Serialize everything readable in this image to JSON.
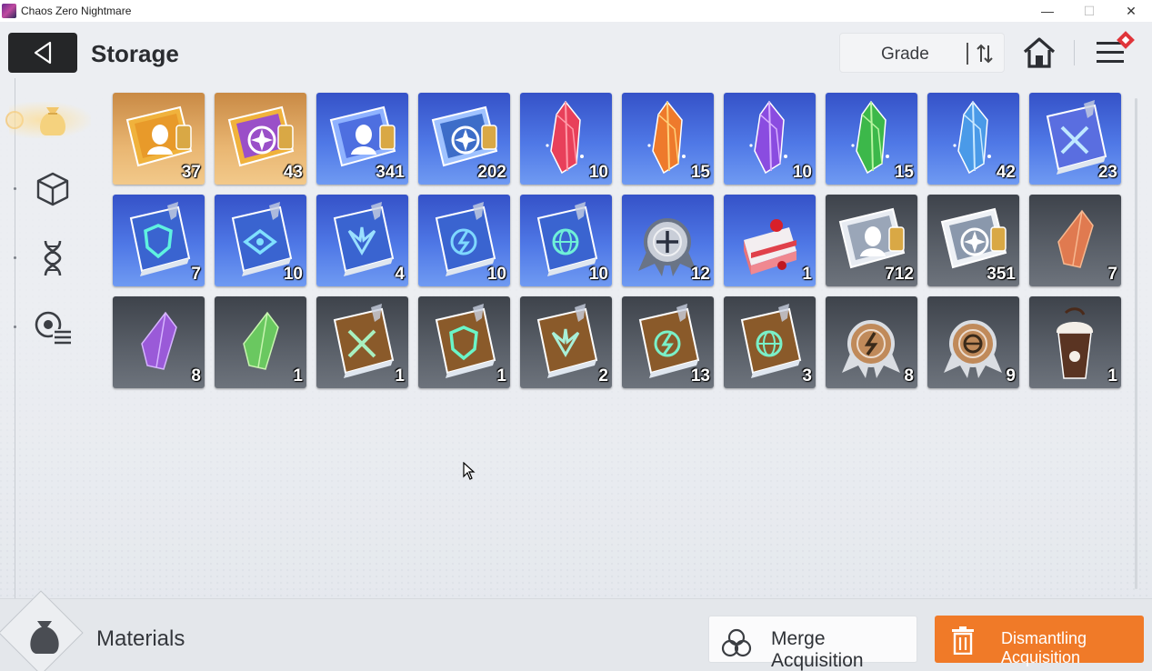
{
  "window": {
    "title": "Chaos Zero Nightmare",
    "controls": {
      "minimize": "—",
      "maximize": "☐",
      "close": "✕"
    }
  },
  "header": {
    "title": "Storage",
    "sort_label": "Grade"
  },
  "sidebar": {
    "tabs": [
      {
        "name": "materials-tab",
        "icon": "money-bag-icon",
        "active": true
      },
      {
        "name": "cube-tab",
        "icon": "cube-icon",
        "active": false
      },
      {
        "name": "dna-tab",
        "icon": "dna-icon",
        "active": false
      },
      {
        "name": "list-tab",
        "icon": "list-settings-icon",
        "active": false
      }
    ]
  },
  "items": [
    {
      "icon": "gold-ticket-portrait",
      "count": "37",
      "frame": "gold"
    },
    {
      "icon": "gold-ticket-star",
      "count": "43",
      "frame": "gold"
    },
    {
      "icon": "blue-ticket-portrait",
      "count": "341",
      "frame": "blue"
    },
    {
      "icon": "blue-ticket-star",
      "count": "202",
      "frame": "blue"
    },
    {
      "icon": "crystal-red",
      "count": "10",
      "frame": "blue"
    },
    {
      "icon": "crystal-orange",
      "count": "15",
      "frame": "blue"
    },
    {
      "icon": "crystal-purple",
      "count": "10",
      "frame": "blue"
    },
    {
      "icon": "crystal-green",
      "count": "15",
      "frame": "blue"
    },
    {
      "icon": "crystal-blue",
      "count": "42",
      "frame": "blue"
    },
    {
      "icon": "blue-book-swords",
      "count": "23",
      "frame": "blue"
    },
    {
      "icon": "blue-book-shield",
      "count": "7",
      "frame": "blue"
    },
    {
      "icon": "blue-book-eye",
      "count": "10",
      "frame": "blue"
    },
    {
      "icon": "blue-book-wings",
      "count": "4",
      "frame": "blue"
    },
    {
      "icon": "blue-book-bolt",
      "count": "10",
      "frame": "blue"
    },
    {
      "icon": "blue-book-globe",
      "count": "10",
      "frame": "blue"
    },
    {
      "icon": "silver-medal",
      "count": "12",
      "frame": "blue"
    },
    {
      "icon": "strawberry-cake",
      "count": "1",
      "frame": "blue"
    },
    {
      "icon": "silver-ticket-portrait",
      "count": "712",
      "frame": "grey"
    },
    {
      "icon": "silver-ticket-star",
      "count": "351",
      "frame": "grey"
    },
    {
      "icon": "shard-orange",
      "count": "7",
      "frame": "grey"
    },
    {
      "icon": "shard-purple",
      "count": "8",
      "frame": "grey"
    },
    {
      "icon": "shard-green",
      "count": "1",
      "frame": "grey"
    },
    {
      "icon": "brown-book-swords",
      "count": "1",
      "frame": "grey"
    },
    {
      "icon": "brown-book-shield",
      "count": "1",
      "frame": "grey"
    },
    {
      "icon": "brown-book-wings",
      "count": "2",
      "frame": "grey"
    },
    {
      "icon": "brown-book-bolt",
      "count": "13",
      "frame": "grey"
    },
    {
      "icon": "brown-book-globe",
      "count": "3",
      "frame": "grey"
    },
    {
      "icon": "bronze-medal-bolt",
      "count": "8",
      "frame": "grey"
    },
    {
      "icon": "bronze-medal-globe",
      "count": "9",
      "frame": "grey"
    },
    {
      "icon": "chocolate-frappe",
      "count": "1",
      "frame": "grey"
    }
  ],
  "footer": {
    "category_label": "Materials",
    "merge_label": "Merge Acquisition",
    "dismantle_label": "Dismantling Acquisition"
  },
  "colors": {
    "gold_frame": "#e9b672",
    "blue_frame": "#4f78e6",
    "grey_frame": "#5b616a",
    "dismantle_button": "#f07a28"
  }
}
